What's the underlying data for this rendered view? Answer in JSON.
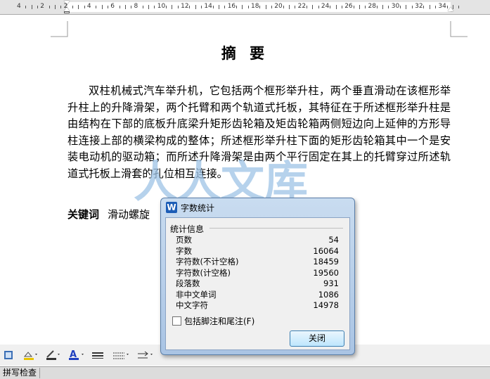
{
  "ruler": {
    "labels": [
      "4",
      "2",
      "2",
      "4",
      "6",
      "8",
      "10",
      "12",
      "14",
      "16",
      "18",
      "20",
      "22",
      "24",
      "26",
      "28",
      "30",
      "32",
      "34"
    ]
  },
  "document": {
    "title": "摘 要",
    "abstract": "双柱机械式汽车举升机，它包括两个框形举升柱，两个垂直滑动在该框形举升柱上的升降滑架，两个托臂和两个轨道式托板，其特征在于所述框形举升柱是由结构在下部的底板升底梁升矩形齿轮箱及矩齿轮箱两侧短边向上延伸的方形导柱连接上部的横梁构成的整体；所述框形举升柱下面的矩形齿轮箱其中一个是安装电动机的驱动箱；而所述升降滑架是由两个平行固定在其上的托臂穿过所述轨道式托板上滑套的孔位相互连接。",
    "keywords_label": "关键词",
    "keywords_value": "滑动螺旋"
  },
  "watermark": {
    "text": "人人文库",
    "url": "renrendoc.com"
  },
  "dialog": {
    "title": "字数统计",
    "group_label": "统计信息",
    "stats": [
      {
        "label": "页数",
        "value": "54"
      },
      {
        "label": "字数",
        "value": "16064"
      },
      {
        "label": "字符数(不计空格)",
        "value": "18459"
      },
      {
        "label": "字符数(计空格)",
        "value": "19560"
      },
      {
        "label": "段落数",
        "value": "931"
      },
      {
        "label": "非中文单词",
        "value": "1086"
      },
      {
        "label": "中文字符",
        "value": "14978"
      }
    ],
    "checkbox_label": "包括脚注和尾注(F)",
    "close_button": "关闭"
  },
  "statusbar": {
    "spell_check": "拼写检查"
  },
  "colors": {
    "dialog_frame": "#a9c4e4",
    "watermark": "#9ec3e6",
    "font_color_icon": "#1f3fbf"
  }
}
